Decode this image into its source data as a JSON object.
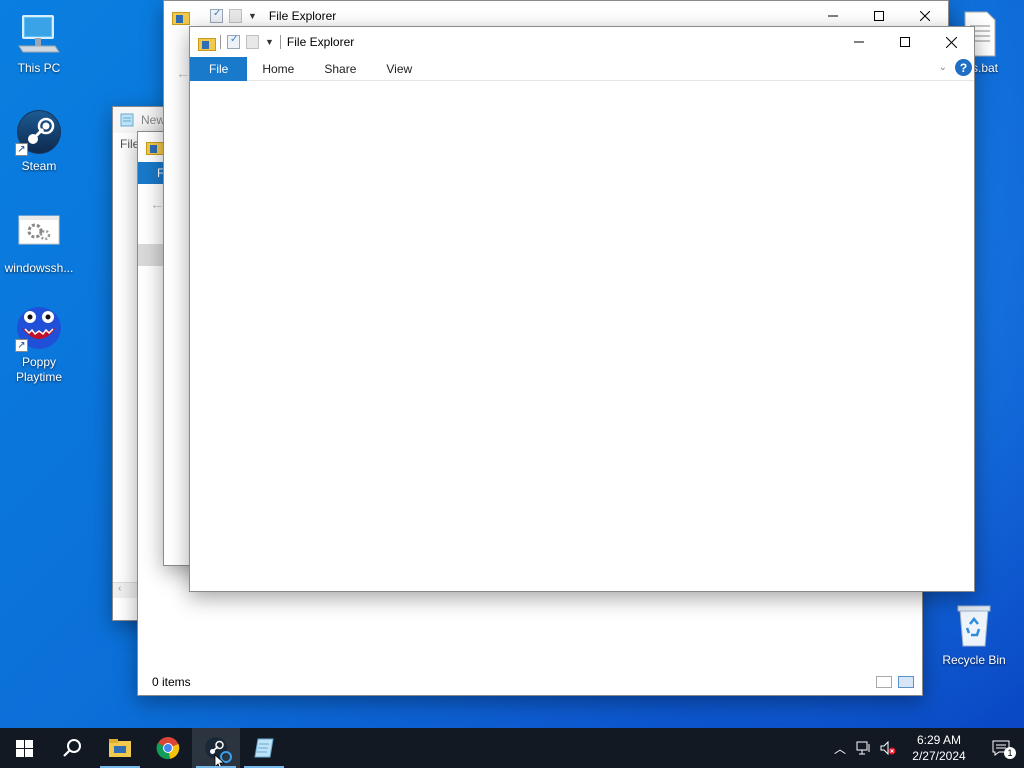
{
  "desktop": {
    "icons": [
      {
        "label": "This PC"
      },
      {
        "label": "Steam"
      },
      {
        "label": "windowssh..."
      },
      {
        "label": "Poppy Playtime"
      },
      {
        "label": "Recycle Bin"
      },
      {
        "label": "s.bat"
      }
    ]
  },
  "back_window_notepad": {
    "title": "New",
    "menu_file": "File"
  },
  "mid_window_explorer": {
    "tab_partial": "F",
    "status": "0 items"
  },
  "explorer_back": {
    "title": "File Explorer"
  },
  "explorer_front": {
    "title": "File Explorer",
    "tabs": [
      "File",
      "Home",
      "Share",
      "View"
    ],
    "help": "?"
  },
  "taskbar": {
    "apps": [
      "start",
      "search",
      "file-explorer",
      "chrome",
      "steam",
      "notepad"
    ],
    "clock_time": "6:29 AM",
    "clock_date": "2/27/2024",
    "notification_count": "1"
  },
  "colors": {
    "accent": "#1979ca",
    "taskbar": "#121923",
    "desktop": "#0b6fd8"
  }
}
